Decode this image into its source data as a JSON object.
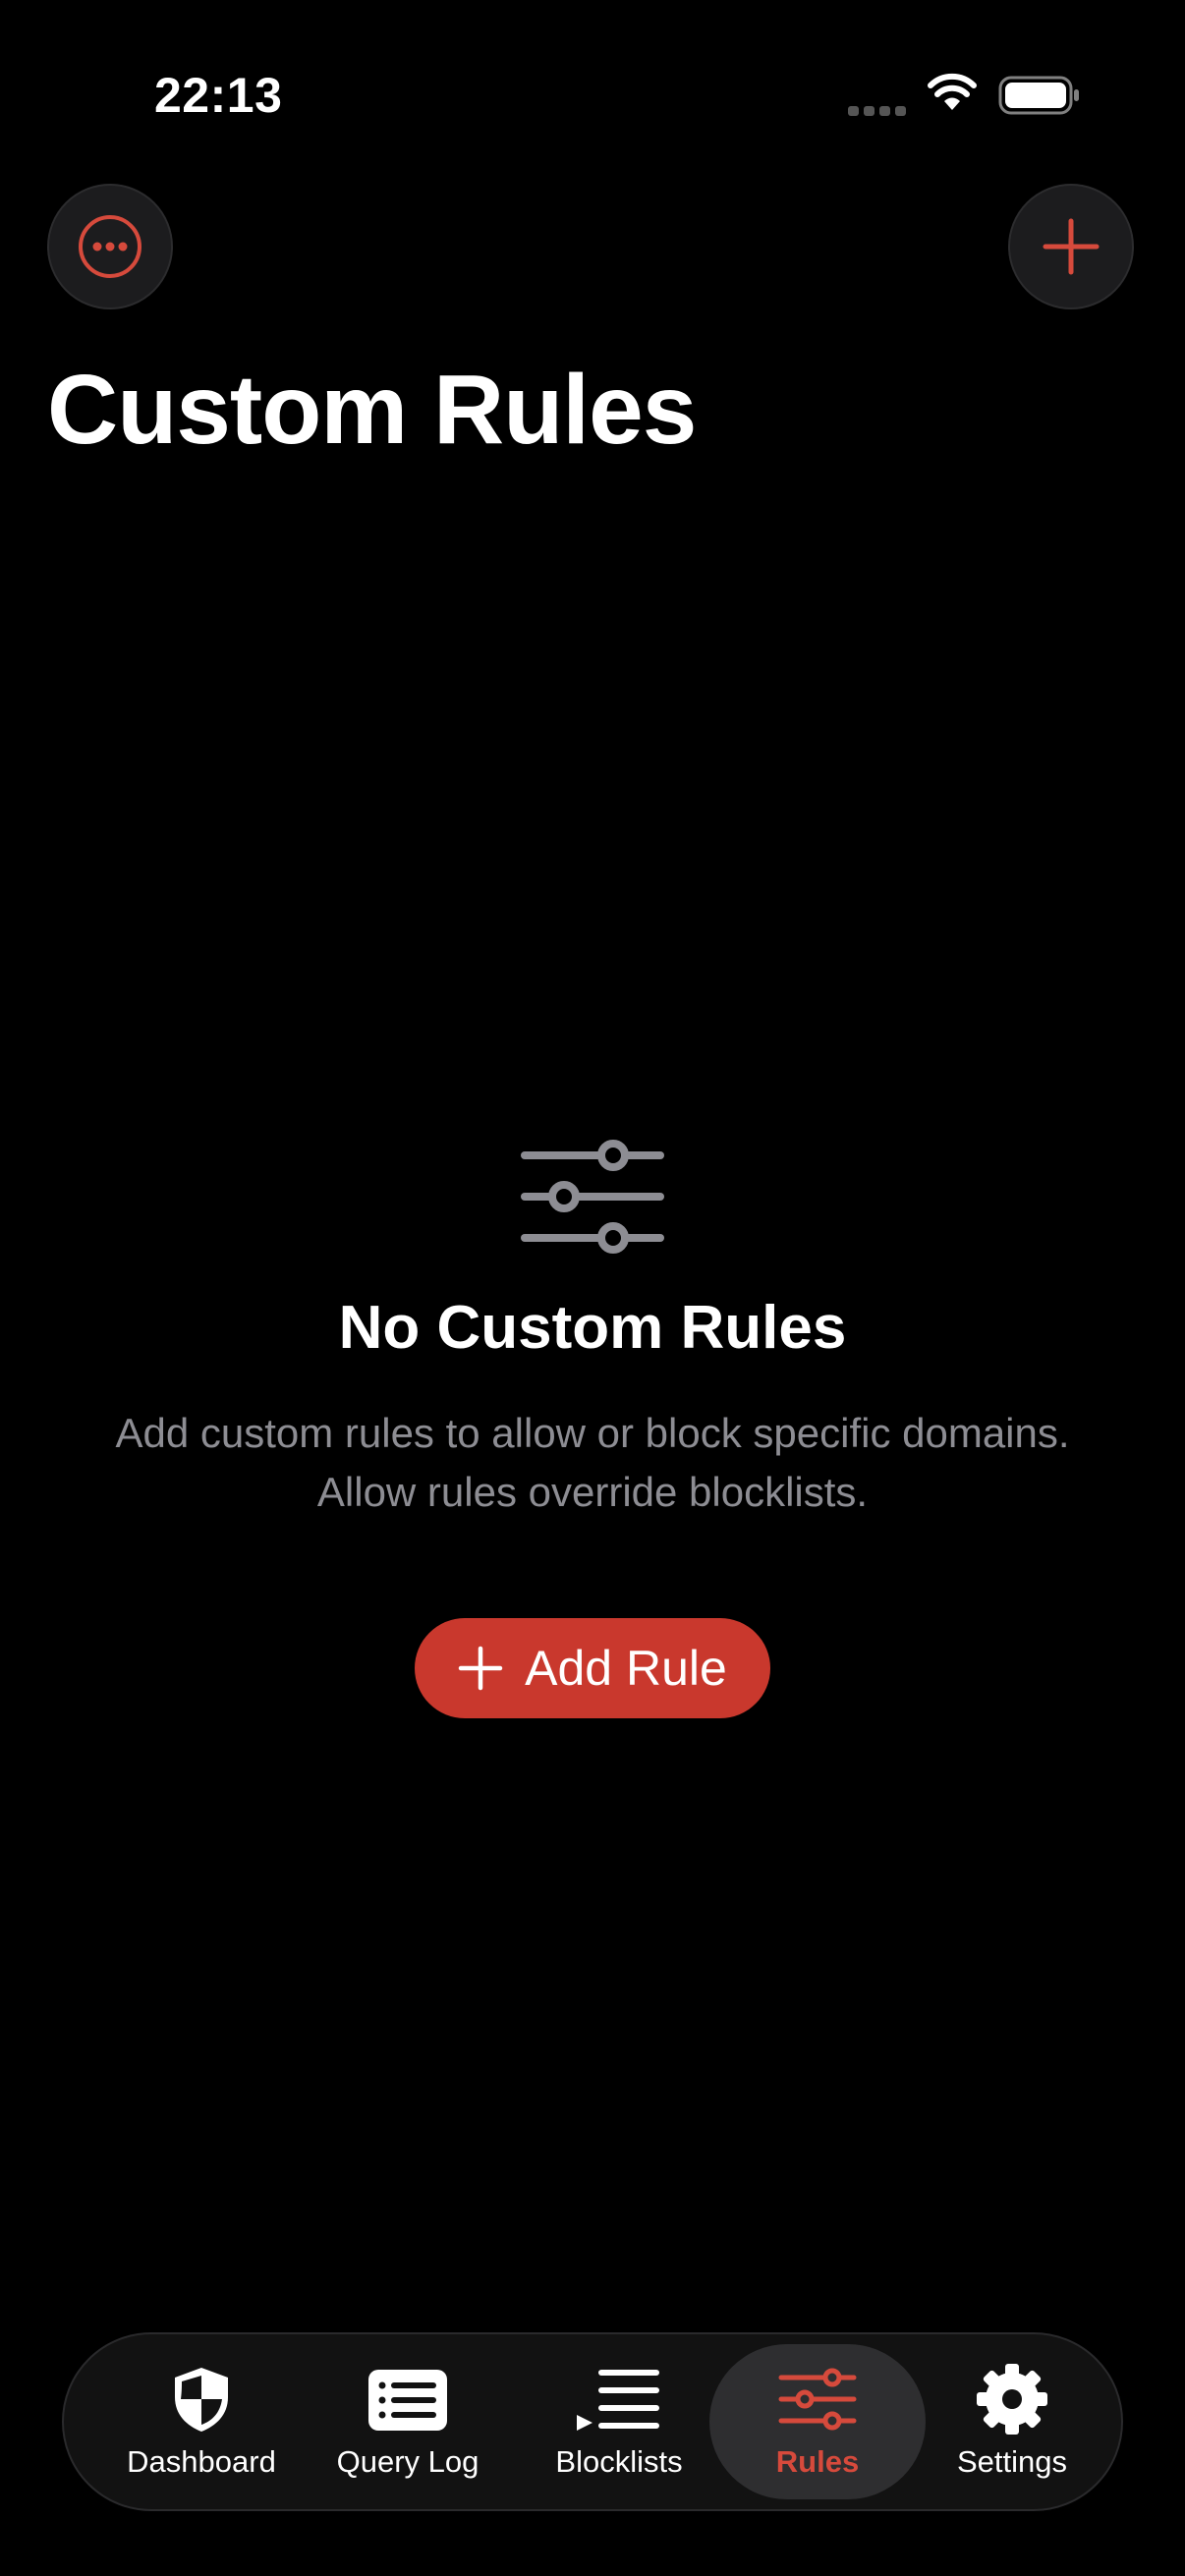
{
  "status_bar": {
    "time": "22:13"
  },
  "header": {
    "title": "Custom Rules"
  },
  "empty_state": {
    "title": "No Custom Rules",
    "description_line1": "Add custom rules to allow or block specific domains.",
    "description_line2": "Allow rules override blocklists.",
    "button_label": "Add Rule"
  },
  "tabs": [
    {
      "label": "Dashboard",
      "icon": "shield-icon",
      "active": false
    },
    {
      "label": "Query Log",
      "icon": "list-icon",
      "active": false
    },
    {
      "label": "Blocklists",
      "icon": "playlist-icon",
      "active": false
    },
    {
      "label": "Rules",
      "icon": "sliders-icon",
      "active": true
    },
    {
      "label": "Settings",
      "icon": "gear-icon",
      "active": false
    }
  ],
  "colors": {
    "accent": "#d64a3c",
    "button": "#c9382d",
    "background": "#000000"
  }
}
